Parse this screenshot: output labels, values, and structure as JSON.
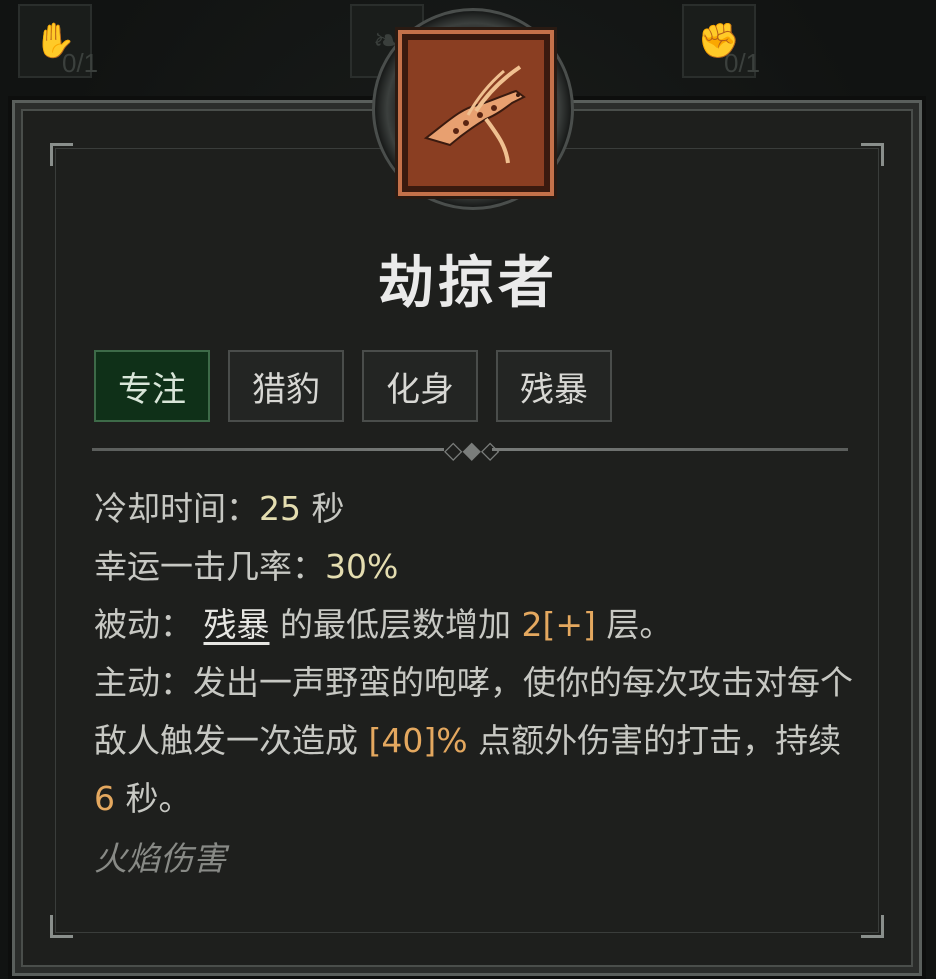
{
  "background": {
    "slots": [
      {
        "icon": "claw-icon",
        "count": "0/1"
      },
      {
        "icon": "beast-icon",
        "count": ""
      },
      {
        "icon": "paw-icon",
        "count": "0/1"
      }
    ]
  },
  "skill": {
    "icon": "jaguar-leap-icon",
    "name": "劫掠者",
    "tags": [
      "专注",
      "猎豹",
      "化身",
      "残暴"
    ],
    "active_tag": "专注",
    "stats": {
      "cooldown_label": "冷却时间：",
      "cooldown_value": "25",
      "cooldown_unit": " 秒",
      "lucky_hit_label": "幸运一击几率：",
      "lucky_hit_value": "30%"
    },
    "passive": {
      "label": "被动：",
      "keyword": "残暴",
      "text_a": " 的最低层数增加 ",
      "value": "2[+]",
      "text_b": " 层。"
    },
    "active": {
      "label": "主动：",
      "text_a": "发出一声野蛮的咆哮，使你的每次攻击对每个敌人触发一次造成 ",
      "value": "[40]%",
      "text_b": " 点额外伤害的打击，持续 ",
      "duration": "6",
      "text_c": " 秒。"
    },
    "damage_type": "火焰伤害"
  },
  "colors": {
    "frame_bg": "#1e1f1d",
    "active_tag_bg": "#0f3018",
    "value_yellow": "#e4ddb0",
    "value_orange": "#e4a85f",
    "icon_bg": "#8a3e22"
  }
}
